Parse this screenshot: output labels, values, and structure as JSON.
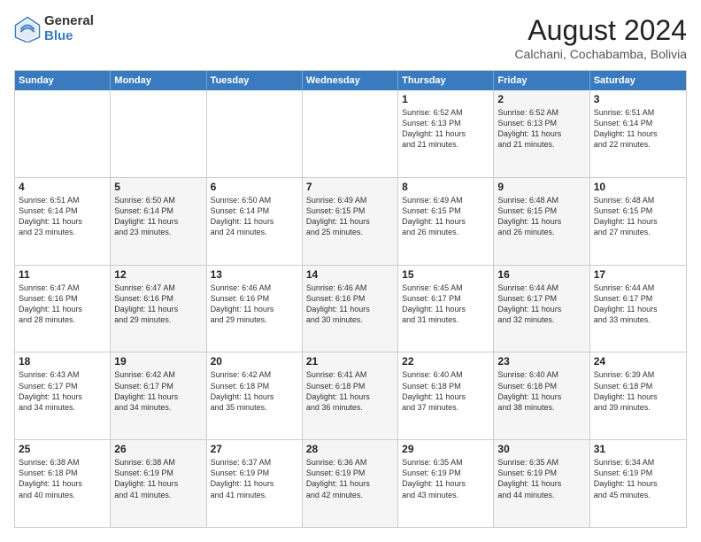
{
  "logo": {
    "general": "General",
    "blue": "Blue"
  },
  "title": "August 2024",
  "location": "Calchani, Cochabamba, Bolivia",
  "days_of_week": [
    "Sunday",
    "Monday",
    "Tuesday",
    "Wednesday",
    "Thursday",
    "Friday",
    "Saturday"
  ],
  "weeks": [
    [
      {
        "day": "",
        "info": "",
        "shaded": false
      },
      {
        "day": "",
        "info": "",
        "shaded": false
      },
      {
        "day": "",
        "info": "",
        "shaded": false
      },
      {
        "day": "",
        "info": "",
        "shaded": false
      },
      {
        "day": "1",
        "info": "Sunrise: 6:52 AM\nSunset: 6:13 PM\nDaylight: 11 hours\nand 21 minutes.",
        "shaded": false
      },
      {
        "day": "2",
        "info": "Sunrise: 6:52 AM\nSunset: 6:13 PM\nDaylight: 11 hours\nand 21 minutes.",
        "shaded": true
      },
      {
        "day": "3",
        "info": "Sunrise: 6:51 AM\nSunset: 6:14 PM\nDaylight: 11 hours\nand 22 minutes.",
        "shaded": false
      }
    ],
    [
      {
        "day": "4",
        "info": "Sunrise: 6:51 AM\nSunset: 6:14 PM\nDaylight: 11 hours\nand 23 minutes.",
        "shaded": false
      },
      {
        "day": "5",
        "info": "Sunrise: 6:50 AM\nSunset: 6:14 PM\nDaylight: 11 hours\nand 23 minutes.",
        "shaded": true
      },
      {
        "day": "6",
        "info": "Sunrise: 6:50 AM\nSunset: 6:14 PM\nDaylight: 11 hours\nand 24 minutes.",
        "shaded": false
      },
      {
        "day": "7",
        "info": "Sunrise: 6:49 AM\nSunset: 6:15 PM\nDaylight: 11 hours\nand 25 minutes.",
        "shaded": true
      },
      {
        "day": "8",
        "info": "Sunrise: 6:49 AM\nSunset: 6:15 PM\nDaylight: 11 hours\nand 26 minutes.",
        "shaded": false
      },
      {
        "day": "9",
        "info": "Sunrise: 6:48 AM\nSunset: 6:15 PM\nDaylight: 11 hours\nand 26 minutes.",
        "shaded": true
      },
      {
        "day": "10",
        "info": "Sunrise: 6:48 AM\nSunset: 6:15 PM\nDaylight: 11 hours\nand 27 minutes.",
        "shaded": false
      }
    ],
    [
      {
        "day": "11",
        "info": "Sunrise: 6:47 AM\nSunset: 6:16 PM\nDaylight: 11 hours\nand 28 minutes.",
        "shaded": false
      },
      {
        "day": "12",
        "info": "Sunrise: 6:47 AM\nSunset: 6:16 PM\nDaylight: 11 hours\nand 29 minutes.",
        "shaded": true
      },
      {
        "day": "13",
        "info": "Sunrise: 6:46 AM\nSunset: 6:16 PM\nDaylight: 11 hours\nand 29 minutes.",
        "shaded": false
      },
      {
        "day": "14",
        "info": "Sunrise: 6:46 AM\nSunset: 6:16 PM\nDaylight: 11 hours\nand 30 minutes.",
        "shaded": true
      },
      {
        "day": "15",
        "info": "Sunrise: 6:45 AM\nSunset: 6:17 PM\nDaylight: 11 hours\nand 31 minutes.",
        "shaded": false
      },
      {
        "day": "16",
        "info": "Sunrise: 6:44 AM\nSunset: 6:17 PM\nDaylight: 11 hours\nand 32 minutes.",
        "shaded": true
      },
      {
        "day": "17",
        "info": "Sunrise: 6:44 AM\nSunset: 6:17 PM\nDaylight: 11 hours\nand 33 minutes.",
        "shaded": false
      }
    ],
    [
      {
        "day": "18",
        "info": "Sunrise: 6:43 AM\nSunset: 6:17 PM\nDaylight: 11 hours\nand 34 minutes.",
        "shaded": false
      },
      {
        "day": "19",
        "info": "Sunrise: 6:42 AM\nSunset: 6:17 PM\nDaylight: 11 hours\nand 34 minutes.",
        "shaded": true
      },
      {
        "day": "20",
        "info": "Sunrise: 6:42 AM\nSunset: 6:18 PM\nDaylight: 11 hours\nand 35 minutes.",
        "shaded": false
      },
      {
        "day": "21",
        "info": "Sunrise: 6:41 AM\nSunset: 6:18 PM\nDaylight: 11 hours\nand 36 minutes.",
        "shaded": true
      },
      {
        "day": "22",
        "info": "Sunrise: 6:40 AM\nSunset: 6:18 PM\nDaylight: 11 hours\nand 37 minutes.",
        "shaded": false
      },
      {
        "day": "23",
        "info": "Sunrise: 6:40 AM\nSunset: 6:18 PM\nDaylight: 11 hours\nand 38 minutes.",
        "shaded": true
      },
      {
        "day": "24",
        "info": "Sunrise: 6:39 AM\nSunset: 6:18 PM\nDaylight: 11 hours\nand 39 minutes.",
        "shaded": false
      }
    ],
    [
      {
        "day": "25",
        "info": "Sunrise: 6:38 AM\nSunset: 6:18 PM\nDaylight: 11 hours\nand 40 minutes.",
        "shaded": false
      },
      {
        "day": "26",
        "info": "Sunrise: 6:38 AM\nSunset: 6:19 PM\nDaylight: 11 hours\nand 41 minutes.",
        "shaded": true
      },
      {
        "day": "27",
        "info": "Sunrise: 6:37 AM\nSunset: 6:19 PM\nDaylight: 11 hours\nand 41 minutes.",
        "shaded": false
      },
      {
        "day": "28",
        "info": "Sunrise: 6:36 AM\nSunset: 6:19 PM\nDaylight: 11 hours\nand 42 minutes.",
        "shaded": true
      },
      {
        "day": "29",
        "info": "Sunrise: 6:35 AM\nSunset: 6:19 PM\nDaylight: 11 hours\nand 43 minutes.",
        "shaded": false
      },
      {
        "day": "30",
        "info": "Sunrise: 6:35 AM\nSunset: 6:19 PM\nDaylight: 11 hours\nand 44 minutes.",
        "shaded": true
      },
      {
        "day": "31",
        "info": "Sunrise: 6:34 AM\nSunset: 6:19 PM\nDaylight: 11 hours\nand 45 minutes.",
        "shaded": false
      }
    ]
  ]
}
